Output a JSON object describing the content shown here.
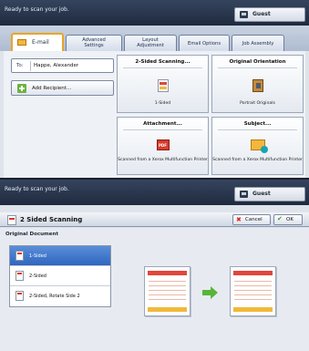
{
  "screen1": {
    "status": "Ready to scan your job.",
    "user": "Guest",
    "tabs": [
      "E-mail",
      "Advanced Settings",
      "Layout Adjustment",
      "Email Options",
      "Job Assembly"
    ],
    "to_label": "To:",
    "to_value": "Happe, Alexander",
    "add_recipient": "Add Recipient...",
    "features": {
      "sides": {
        "title": "2-Sided Scanning...",
        "value": "1-Sided"
      },
      "orientation": {
        "title": "Original Orientation",
        "value": "Portrait Originals"
      },
      "attachment": {
        "title": "Attachment...",
        "value": "Scanned from a Xerox Multifunction Printer",
        "icon_text": "PDF"
      },
      "subject": {
        "title": "Subject...",
        "value": "Scanned from a Xerox Multifunction Printer"
      }
    }
  },
  "screen2": {
    "status": "Ready to scan your job.",
    "user": "Guest",
    "title": "2 Sided Scanning",
    "cancel": "Cancel",
    "ok": "OK",
    "section_label": "Original Document",
    "options": [
      "1-Sided",
      "2-Sided",
      "2-Sided, Rotate Side 2"
    ],
    "selected": "1-Sided"
  },
  "colors": {
    "status_bar": "#1f2a3e",
    "active_tab_border": "#e8a626",
    "selection": "#2f66c0",
    "arrow": "#58b53a"
  }
}
